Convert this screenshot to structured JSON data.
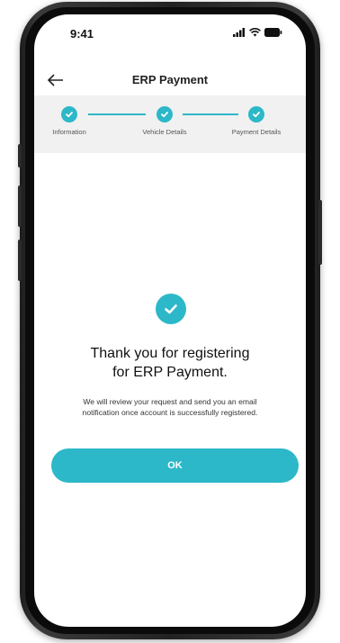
{
  "status_bar": {
    "time": "9:41",
    "icons": [
      "signal-icon",
      "wifi-icon",
      "battery-icon"
    ]
  },
  "header": {
    "back_icon": "back-arrow-icon",
    "title": "ERP Payment"
  },
  "stepper": {
    "steps": [
      {
        "label": "Information",
        "state": "complete"
      },
      {
        "label": "Vehicle Details",
        "state": "complete"
      },
      {
        "label": "Payment Details",
        "state": "complete"
      }
    ]
  },
  "confirmation": {
    "icon": "check-circle-icon",
    "title_line1": "Thank you for registering",
    "title_line2": "for ERP Payment.",
    "message_line1": "We will review your request and send you an email",
    "message_line2": "notification once account is successfully registered."
  },
  "actions": {
    "ok_label": "OK"
  },
  "colors": {
    "accent": "#2db8c9",
    "stepper_background": "#f1f1f1"
  }
}
